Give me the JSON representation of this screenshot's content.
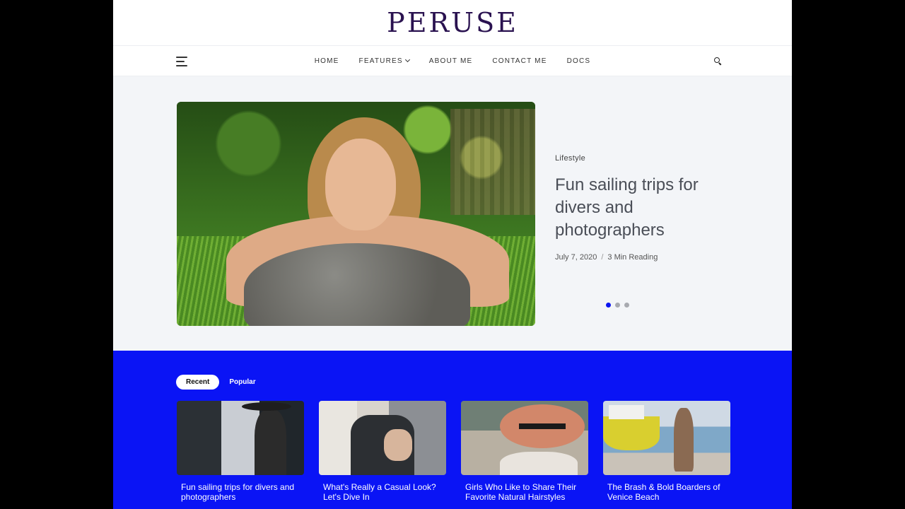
{
  "site": {
    "logo": "PERUSE"
  },
  "nav": {
    "items": [
      {
        "label": "HOME"
      },
      {
        "label": "FEATURES",
        "has_dropdown": true
      },
      {
        "label": "ABOUT ME"
      },
      {
        "label": "CONTACT ME"
      },
      {
        "label": "DOCS"
      }
    ]
  },
  "hero": {
    "category": "Lifestyle",
    "title": "Fun sailing trips for divers and photographers",
    "date": "July 7, 2020",
    "separator": "/",
    "reading": "3 Min Reading",
    "slides": 3,
    "active_slide": 1
  },
  "tabs": [
    {
      "label": "Recent",
      "active": true
    },
    {
      "label": "Popular",
      "active": false
    }
  ],
  "posts": [
    {
      "title": "Fun sailing trips for divers and photographers"
    },
    {
      "title": "What's Really a Casual Look? Let's Dive In"
    },
    {
      "title": "Girls Who Like to Share Their Favorite Natural Hairstyles"
    },
    {
      "title": "The Brash & Bold Boarders of Venice Beach"
    }
  ],
  "colors": {
    "accent": "#0a14f5",
    "logo": "#2a1250",
    "hero_bg": "#f3f5f8"
  }
}
